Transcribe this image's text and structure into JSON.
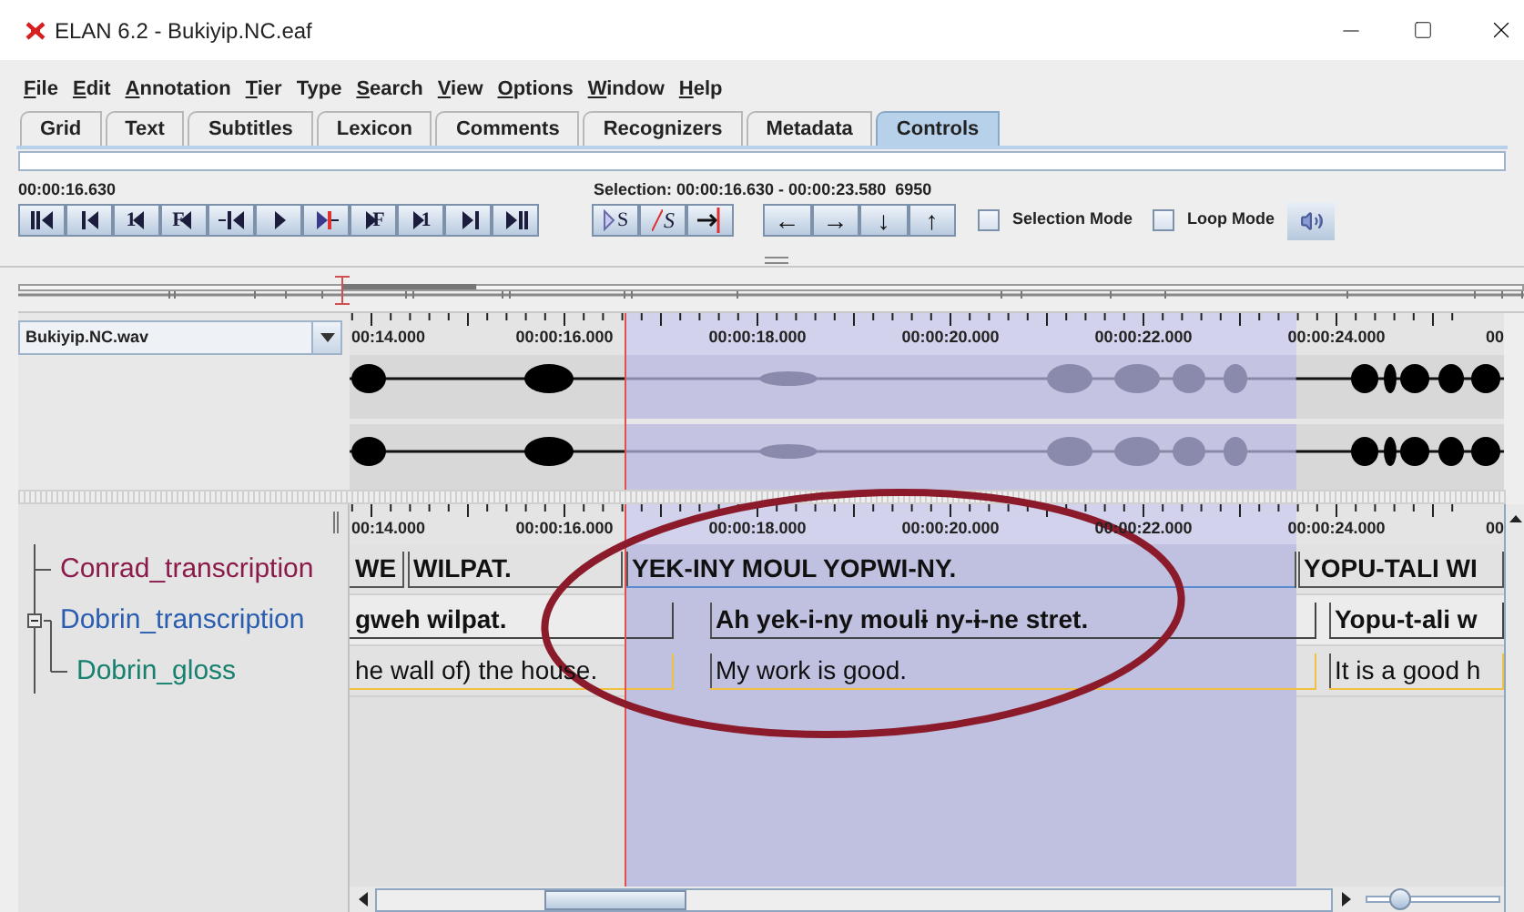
{
  "window": {
    "title": "ELAN 6.2 - Bukiyip.NC.eaf"
  },
  "menu": [
    {
      "label": "File",
      "mnemonic": true
    },
    {
      "label": "Edit",
      "mnemonic": true
    },
    {
      "label": "Annotation",
      "mnemonic": true
    },
    {
      "label": "Tier",
      "mnemonic": true
    },
    {
      "label": "Type",
      "mnemonic": false
    },
    {
      "label": "Search",
      "mnemonic": true
    },
    {
      "label": "View",
      "mnemonic": true
    },
    {
      "label": "Options",
      "mnemonic": true
    },
    {
      "label": "Window",
      "mnemonic": true
    },
    {
      "label": "Help",
      "mnemonic": true
    }
  ],
  "tabs": [
    {
      "label": "Grid",
      "selected": false
    },
    {
      "label": "Text",
      "selected": false
    },
    {
      "label": "Subtitles",
      "selected": false
    },
    {
      "label": "Lexicon",
      "selected": false
    },
    {
      "label": "Comments",
      "selected": false
    },
    {
      "label": "Recognizers",
      "selected": false
    },
    {
      "label": "Metadata",
      "selected": false
    },
    {
      "label": "Controls",
      "selected": true
    }
  ],
  "media_time": "00:00:16.630",
  "selection_info": "Selection: 00:00:16.630 - 00:00:23.580  6950",
  "player_buttons": [
    {
      "kind": "begin"
    },
    {
      "kind": "prev-second"
    },
    {
      "kind": "labeled-back",
      "label": "1"
    },
    {
      "kind": "labeled-back",
      "label": "F"
    },
    {
      "kind": "prev-pixel"
    },
    {
      "kind": "play"
    },
    {
      "kind": "next-pixel"
    },
    {
      "kind": "labeled-forward",
      "label": "F"
    },
    {
      "kind": "labeled-forward",
      "label": "1"
    },
    {
      "kind": "next-second"
    },
    {
      "kind": "end"
    }
  ],
  "selection_buttons": [
    {
      "kind": "play-selection",
      "label": "S"
    },
    {
      "kind": "clear-selection",
      "label": "S"
    },
    {
      "kind": "to-selection-edge"
    }
  ],
  "nav_buttons": [
    {
      "label": "←"
    },
    {
      "label": "→"
    },
    {
      "label": "↓"
    },
    {
      "label": "↑"
    }
  ],
  "options": [
    {
      "label": "Selection Mode",
      "checked": false
    },
    {
      "label": "Loop Mode",
      "checked": false
    }
  ],
  "media_file": "Bukiyip.NC.wav",
  "media_slider": {
    "level": 0.215
  },
  "wave_ruler_labels": [
    "00:14.000",
    "00:00:16.000",
    "00:00:18.000",
    "00:00:20.000",
    "00:00:22.000",
    "00:00:24.000",
    "00"
  ],
  "tier_ruler_labels": [
    "00:14.000",
    "00:00:16.000",
    "00:00:18.000",
    "00:00:20.000",
    "00:00:22.000",
    "00:00:24.000",
    "00"
  ],
  "zoom_slider": {
    "level": 0.17
  },
  "tiers": [
    {
      "name": "Conrad_transcription",
      "color": "#8b1a4a",
      "annotations": [
        {
          "text": "WE",
          "active": false
        },
        {
          "text": "WILPAT.",
          "active": false
        },
        {
          "text": "YEK-INY MOUL YOPWI-NY.",
          "active": true
        },
        {
          "text": "YOPU-TALI WI",
          "active": false
        }
      ]
    },
    {
      "name": "Dobrin_transcription",
      "color": "#2a5db0",
      "expanded": true,
      "annotations": [
        {
          "text": "gweh wilpat.",
          "active": false
        },
        {
          "text": "Ah yek-i-ny moulɨ ny-ɨ-ne stret.",
          "active": false
        },
        {
          "text": "Yopu-t-ali w",
          "active": false
        }
      ],
      "children": [
        {
          "name": "Dobrin_gloss",
          "color": "#17806f",
          "annotations": [
            {
              "text": "he wall of) the house.",
              "active": false
            },
            {
              "text": "My work is good.",
              "active": false
            },
            {
              "text": "It is a good h",
              "active": false
            }
          ]
        }
      ]
    }
  ]
}
